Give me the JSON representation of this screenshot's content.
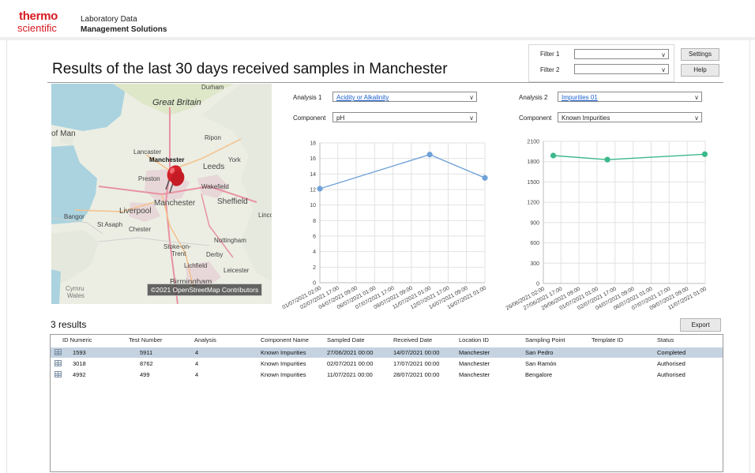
{
  "brand": {
    "line1": "thermo",
    "line2": "scientific"
  },
  "app": {
    "line1": "Laboratory Data",
    "line2": "Management Solutions"
  },
  "page_title": "Results of the last 30 days received samples in Manchester",
  "filters": {
    "filter1_label": "Filter 1",
    "filter1_value": "",
    "filter2_label": "Filter 2",
    "filter2_value": ""
  },
  "buttons": {
    "settings": "Settings",
    "help": "Help",
    "export": "Export"
  },
  "map": {
    "attribution": "©2021 OpenStreetMap Contributors",
    "labels": {
      "great_britain": "Great Britain",
      "durham": "Durham",
      "isle_of_man": "of Man",
      "ripon": "Ripon",
      "lancaster": "Lancaster",
      "manchester_bold": "Manchester",
      "york": "York",
      "leeds": "Leeds",
      "preston": "Preston",
      "wakefield": "Wakefield",
      "manchester": "Manchester",
      "sheffield": "Sheffield",
      "liverpool": "Liverpool",
      "lincoln": "Lincol",
      "bangor": "Bangor",
      "st_asaph": "St Asaph",
      "chester": "Chester",
      "nottingham": "Nottingham",
      "stoke1": "Stoke-on-",
      "stoke2": "Trent",
      "derby": "Derby",
      "lichfield": "Lichfield",
      "leicester": "Leicester",
      "birmingham": "Birmingham",
      "wales": "Wales",
      "cymru": "Cymru"
    }
  },
  "analysis1": {
    "label": "Analysis 1",
    "value": "Acidity or Alkalinity",
    "component_label": "Component",
    "component_value": "pH"
  },
  "analysis2": {
    "label": "Analysis 2",
    "value": "Impurities 01",
    "component_label": "Component",
    "component_value": "Known Impurities"
  },
  "chart_data": [
    {
      "type": "line",
      "x": [
        "01/07/2021 02:00",
        "02/07/2021 17:00",
        "04/07/2021 09:00",
        "06/07/2021 01:00",
        "07/07/2021 17:00",
        "09/07/2021 09:00",
        "11/07/2021 01:00",
        "12/07/2021 17:00",
        "14/07/2021 09:00",
        "16/07/2021 01:00"
      ],
      "series": [
        {
          "points": [
            [
              "01/07/2021 02:00",
              12.1
            ],
            [
              "11/07/2021 01:00",
              16.5
            ],
            [
              "16/07/2021 01:00",
              13.5
            ]
          ]
        }
      ],
      "ylim": [
        0,
        18
      ],
      "yticks": [
        0,
        2,
        4,
        6,
        8,
        10,
        12,
        14,
        16,
        18
      ],
      "color": "#6fa1d8",
      "grid": true
    },
    {
      "type": "line",
      "x": [
        "26/06/2021 02:00",
        "27/06/2021 17:00",
        "29/06/2021 09:00",
        "01/07/2021 01:00",
        "02/07/2021 17:00",
        "04/07/2021 09:00",
        "06/07/2021 01:00",
        "07/07/2021 17:00",
        "09/07/2021 09:00",
        "11/07/2021 01:00"
      ],
      "series": [
        {
          "points": [
            [
              "27/06/2021 00:00",
              1890
            ],
            [
              "02/07/2021 00:00",
              1830
            ],
            [
              "11/07/2021 00:00",
              1910
            ]
          ]
        }
      ],
      "ylim": [
        0,
        2100
      ],
      "yticks": [
        0,
        300,
        600,
        900,
        1200,
        1500,
        1800,
        2100
      ],
      "color": "#3cb88a",
      "grid": true
    }
  ],
  "results": {
    "count_text": "3 results",
    "columns": [
      "ID Numeric",
      "Test Number",
      "Analysis",
      "Component Name",
      "Sampled Date",
      "Received Date",
      "Location ID",
      "Sampling Point",
      "Template ID",
      "Status"
    ],
    "rows": [
      [
        "1593",
        "5911",
        "4",
        "Known Impurities",
        "27/06/2021 00:00",
        "14/07/2021 00:00",
        "Manchester",
        "San Pedro",
        "",
        "Completed"
      ],
      [
        "3018",
        "8762",
        "4",
        "Known Impurities",
        "02/07/2021 00:00",
        "17/07/2021 00:00",
        "Manchester",
        "San Ramón",
        "",
        "Authorised"
      ],
      [
        "4992",
        "499",
        "4",
        "Known Impurities",
        "11/07/2021 00:00",
        "28/07/2021 00:00",
        "Manchester",
        "Bengalore",
        "",
        "Authorised"
      ]
    ]
  }
}
